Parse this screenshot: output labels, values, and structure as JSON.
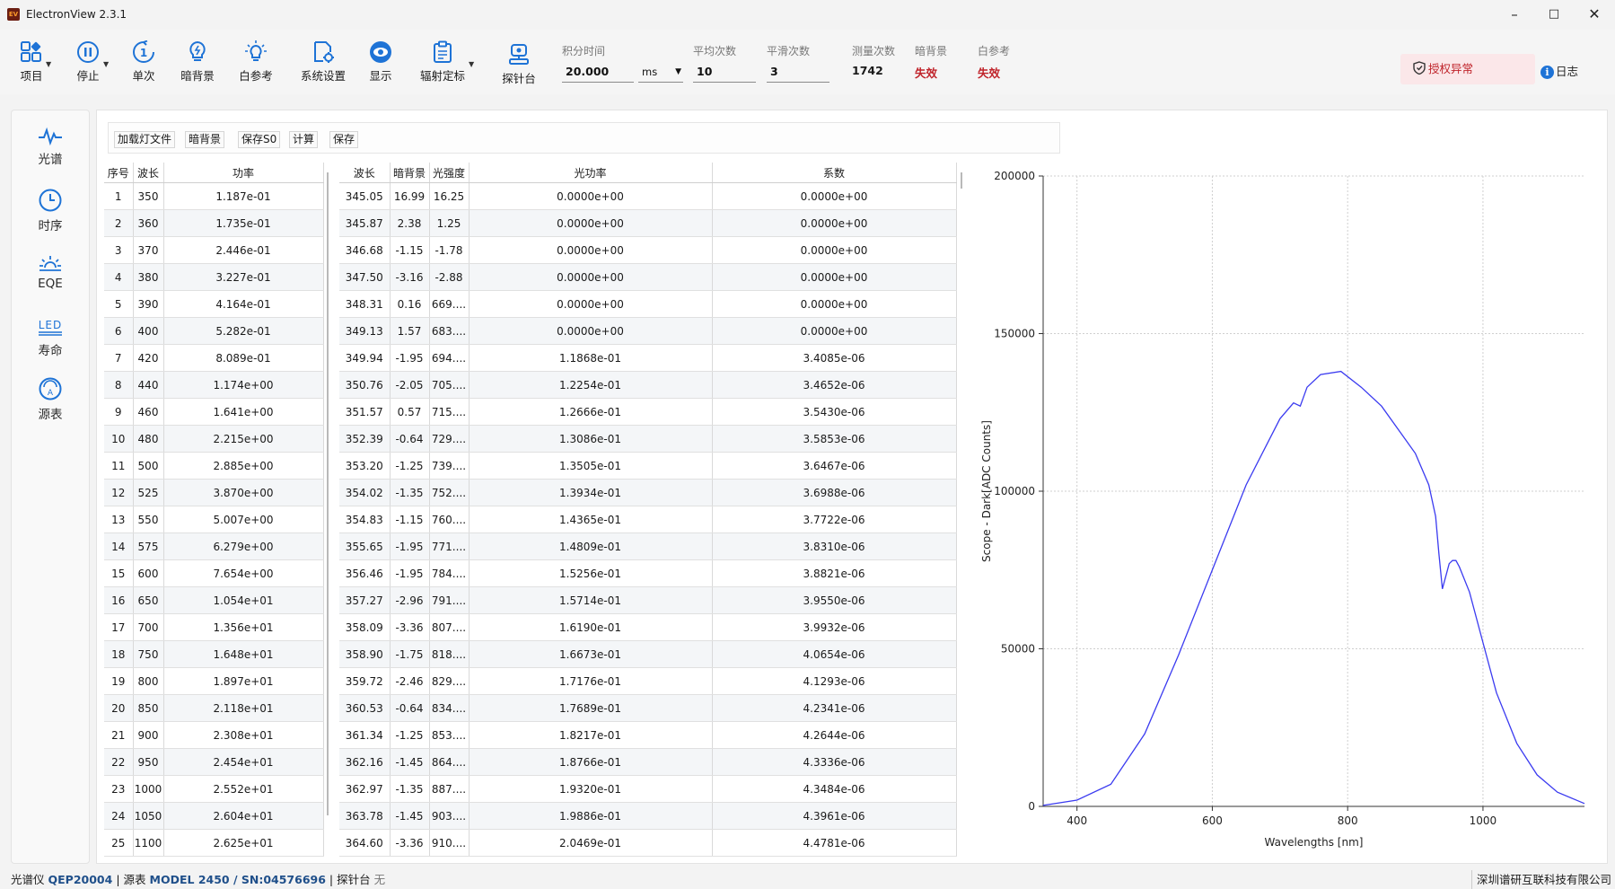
{
  "app": {
    "title": "ElectronView 2.3.1",
    "logo_text": "EV"
  },
  "window_controls": [
    "minimize",
    "maximize",
    "close"
  ],
  "toolbar": {
    "project": "项目",
    "stop": "停止",
    "single": "单次",
    "dark_bg": "暗背景",
    "white_ref": "白参考",
    "settings": "系统设置",
    "display": "显示",
    "radiometric_cal": "辐射定标",
    "probe": "探针台",
    "integration_time_label": "积分时间",
    "integration_time_value": "20.000",
    "unit": "ms",
    "average_label": "平均次数",
    "average_value": "10",
    "smooth_label": "平滑次数",
    "smooth_value": "3",
    "measure_count_label": "测量次数",
    "measure_count_value": "1742",
    "dark_label": "暗背景",
    "dark_status": "失效",
    "white_label": "白参考",
    "white_status": "失效",
    "license_status": "授权异常",
    "log": "日志",
    "colors": {
      "accent": "#1e73d6",
      "alert": "#c0242b",
      "alert_bg": "#fbe7e9"
    }
  },
  "nav": [
    {
      "label": "光谱",
      "icon": "spectrum-icon"
    },
    {
      "label": "时序",
      "icon": "clock-icon"
    },
    {
      "label": "EQE",
      "icon": "sun-icon"
    },
    {
      "label": "寿命",
      "icon": "led-icon"
    },
    {
      "label": "源表",
      "icon": "gauge-icon"
    }
  ],
  "sub_toolbar": [
    "加载灯文件",
    "暗背景",
    "保存S0",
    "计算",
    "保存"
  ],
  "left_table": {
    "headers": [
      "序号",
      "波长",
      "功率"
    ],
    "rows": [
      [
        "1",
        "350",
        "1.187e-01"
      ],
      [
        "2",
        "360",
        "1.735e-01"
      ],
      [
        "3",
        "370",
        "2.446e-01"
      ],
      [
        "4",
        "380",
        "3.227e-01"
      ],
      [
        "5",
        "390",
        "4.164e-01"
      ],
      [
        "6",
        "400",
        "5.282e-01"
      ],
      [
        "7",
        "420",
        "8.089e-01"
      ],
      [
        "8",
        "440",
        "1.174e+00"
      ],
      [
        "9",
        "460",
        "1.641e+00"
      ],
      [
        "10",
        "480",
        "2.215e+00"
      ],
      [
        "11",
        "500",
        "2.885e+00"
      ],
      [
        "12",
        "525",
        "3.870e+00"
      ],
      [
        "13",
        "550",
        "5.007e+00"
      ],
      [
        "14",
        "575",
        "6.279e+00"
      ],
      [
        "15",
        "600",
        "7.654e+00"
      ],
      [
        "16",
        "650",
        "1.054e+01"
      ],
      [
        "17",
        "700",
        "1.356e+01"
      ],
      [
        "18",
        "750",
        "1.648e+01"
      ],
      [
        "19",
        "800",
        "1.897e+01"
      ],
      [
        "20",
        "850",
        "2.118e+01"
      ],
      [
        "21",
        "900",
        "2.308e+01"
      ],
      [
        "22",
        "950",
        "2.454e+01"
      ],
      [
        "23",
        "1000",
        "2.552e+01"
      ],
      [
        "24",
        "1050",
        "2.604e+01"
      ],
      [
        "25",
        "1100",
        "2.625e+01"
      ]
    ]
  },
  "right_table": {
    "headers": [
      "波长",
      "暗背景",
      "光强度",
      "光功率",
      "系数"
    ],
    "rows": [
      [
        "345.05",
        "16.99",
        "16.25",
        "0.0000e+00",
        "0.0000e+00"
      ],
      [
        "345.87",
        "2.38",
        "1.25",
        "0.0000e+00",
        "0.0000e+00"
      ],
      [
        "346.68",
        "-1.15",
        "-1.78",
        "0.0000e+00",
        "0.0000e+00"
      ],
      [
        "347.50",
        "-3.16",
        "-2.88",
        "0.0000e+00",
        "0.0000e+00"
      ],
      [
        "348.31",
        "0.16",
        "669....",
        "0.0000e+00",
        "0.0000e+00"
      ],
      [
        "349.13",
        "1.57",
        "683....",
        "0.0000e+00",
        "0.0000e+00"
      ],
      [
        "349.94",
        "-1.95",
        "694....",
        "1.1868e-01",
        "3.4085e-06"
      ],
      [
        "350.76",
        "-2.05",
        "705....",
        "1.2254e-01",
        "3.4652e-06"
      ],
      [
        "351.57",
        "0.57",
        "715....",
        "1.2666e-01",
        "3.5430e-06"
      ],
      [
        "352.39",
        "-0.64",
        "729....",
        "1.3086e-01",
        "3.5853e-06"
      ],
      [
        "353.20",
        "-1.25",
        "739....",
        "1.3505e-01",
        "3.6467e-06"
      ],
      [
        "354.02",
        "-1.35",
        "752....",
        "1.3934e-01",
        "3.6988e-06"
      ],
      [
        "354.83",
        "-1.15",
        "760....",
        "1.4365e-01",
        "3.7722e-06"
      ],
      [
        "355.65",
        "-1.95",
        "771....",
        "1.4809e-01",
        "3.8310e-06"
      ],
      [
        "356.46",
        "-1.95",
        "784....",
        "1.5256e-01",
        "3.8821e-06"
      ],
      [
        "357.27",
        "-2.96",
        "791....",
        "1.5714e-01",
        "3.9550e-06"
      ],
      [
        "358.09",
        "-3.36",
        "807....",
        "1.6190e-01",
        "3.9932e-06"
      ],
      [
        "358.90",
        "-1.75",
        "818....",
        "1.6673e-01",
        "4.0654e-06"
      ],
      [
        "359.72",
        "-2.46",
        "829....",
        "1.7176e-01",
        "4.1293e-06"
      ],
      [
        "360.53",
        "-0.64",
        "834....",
        "1.7689e-01",
        "4.2341e-06"
      ],
      [
        "361.34",
        "-1.25",
        "853....",
        "1.8217e-01",
        "4.2644e-06"
      ],
      [
        "362.16",
        "-1.45",
        "864....",
        "1.8766e-01",
        "4.3336e-06"
      ],
      [
        "362.97",
        "-1.35",
        "887....",
        "1.9320e-01",
        "4.3484e-06"
      ],
      [
        "363.78",
        "-1.45",
        "903....",
        "1.9886e-01",
        "4.3961e-06"
      ],
      [
        "364.60",
        "-3.36",
        "910....",
        "2.0469e-01",
        "4.4781e-06"
      ]
    ]
  },
  "chart_data": {
    "type": "line",
    "xlabel": "Wavelengths [nm]",
    "ylabel": "Scope - Dark[ADC Counts]",
    "xlim": [
      350,
      1150
    ],
    "ylim": [
      0,
      200000
    ],
    "xticks": [
      400,
      600,
      800,
      1000
    ],
    "yticks": [
      0,
      50000,
      100000,
      150000,
      200000
    ],
    "grid": true,
    "color": "#3b3bf0",
    "x": [
      350,
      400,
      450,
      500,
      550,
      600,
      650,
      700,
      720,
      730,
      740,
      760,
      790,
      820,
      850,
      880,
      900,
      920,
      930,
      935,
      940,
      945,
      950,
      955,
      960,
      965,
      980,
      1000,
      1020,
      1050,
      1080,
      1110,
      1140,
      1150
    ],
    "y": [
      300,
      2000,
      7000,
      23000,
      48000,
      75000,
      102000,
      123000,
      128000,
      127000,
      133000,
      137000,
      138000,
      133000,
      127000,
      118000,
      112000,
      102000,
      92000,
      80000,
      69000,
      73000,
      77000,
      78000,
      78000,
      76000,
      68000,
      52000,
      36000,
      20000,
      10000,
      4500,
      1800,
      900
    ]
  },
  "status_bar": {
    "spectrometer_label": "光谱仪",
    "spectrometer_value": "QEP20004",
    "source_label": "源表",
    "source_value": "MODEL 2450 / SN:04576696",
    "probe_label": "探针台",
    "probe_value": "无",
    "company": "深圳谱研互联科技有限公司"
  }
}
